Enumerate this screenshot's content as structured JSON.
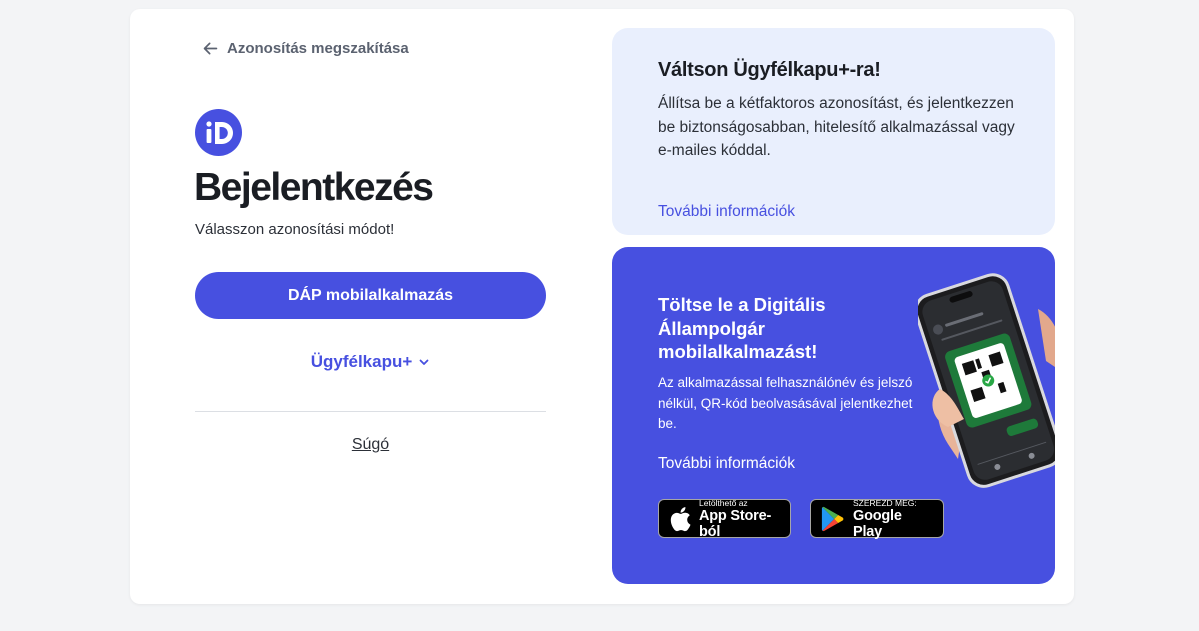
{
  "back_link": {
    "label": "Azonosítás megszakítása",
    "icon": "arrow-left-icon"
  },
  "logo": {
    "text": "iD",
    "color": "#4750e0"
  },
  "title": "Bejelentkezés",
  "subtitle": "Válasszon azonosítási módot!",
  "primary_button": {
    "label": "DÁP mobilalkalmazás"
  },
  "dropdown": {
    "label": "Ügyfélkapu+",
    "icon": "chevron-down-icon"
  },
  "help_link": {
    "label": "Súgó"
  },
  "info_panel": {
    "title": "Váltson Ügyfélkapu+-ra!",
    "text": "Állítsa be a kétfaktoros azonosítást, és jelentkezzen be biztonságosabban, hitelesítő alkalmazással vagy e-mailes kóddal.",
    "link": "További információk",
    "background": "#e9effd"
  },
  "promo_panel": {
    "title": "Töltse le a Digitális Állampolgár mobilalkalmazást!",
    "text": "Az alkalmazással felhasználónév és jelszó nélkül, QR-kód beolvasásával jelentkezhet be.",
    "link": "További információk",
    "background": "#4750e0",
    "app_store": {
      "small": "Letölthető az",
      "big": "App Store-ból",
      "icon": "apple-icon"
    },
    "google_play": {
      "small": "SZEREZD MEG:",
      "big": "Google Play",
      "icon": "google-play-icon"
    }
  },
  "colors": {
    "accent": "#4750e0",
    "page_background": "#f3f4f6",
    "card_background": "#ffffff"
  }
}
